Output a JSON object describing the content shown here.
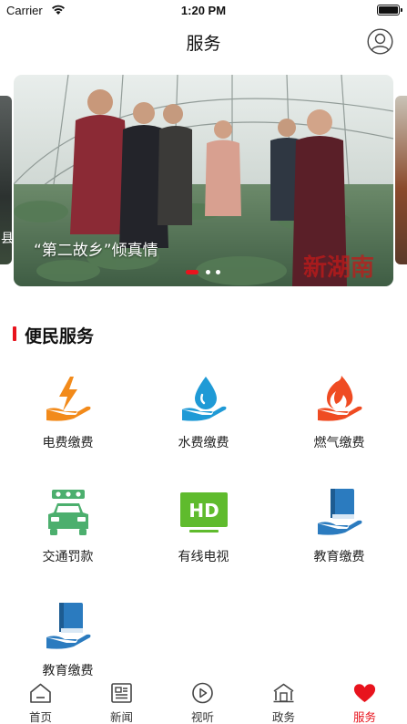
{
  "status_bar": {
    "carrier": "Carrier",
    "time": "1:20 PM"
  },
  "nav": {
    "title": "服务",
    "avatar_icon": "user-circle-icon"
  },
  "banner": {
    "caption": "“第二故乡”倾真情",
    "left_peek_text": "县",
    "watermark": "新湖南",
    "slide_count": 3,
    "active_slide": 1
  },
  "section": {
    "title": "便民服务",
    "accent": "#e8131d"
  },
  "services": [
    {
      "label": "电费缴费",
      "icon": "electricity-hand-icon"
    },
    {
      "label": "水费缴费",
      "icon": "water-drop-hand-icon"
    },
    {
      "label": "燃气缴费",
      "icon": "gas-flame-hand-icon"
    },
    {
      "label": "交通罚款",
      "icon": "car-icon"
    },
    {
      "label": "有线电视",
      "icon": "hd-tv-icon"
    },
    {
      "label": "教育缴费",
      "icon": "book-hand-icon"
    },
    {
      "label": "教育缴费",
      "icon": "book-hand-icon"
    }
  ],
  "tabs": [
    {
      "label": "首页",
      "icon": "home-icon"
    },
    {
      "label": "新闻",
      "icon": "news-icon"
    },
    {
      "label": "视听",
      "icon": "play-circle-icon"
    },
    {
      "label": "政务",
      "icon": "government-building-icon"
    },
    {
      "label": "服务",
      "icon": "heart-icon",
      "active": true
    }
  ]
}
